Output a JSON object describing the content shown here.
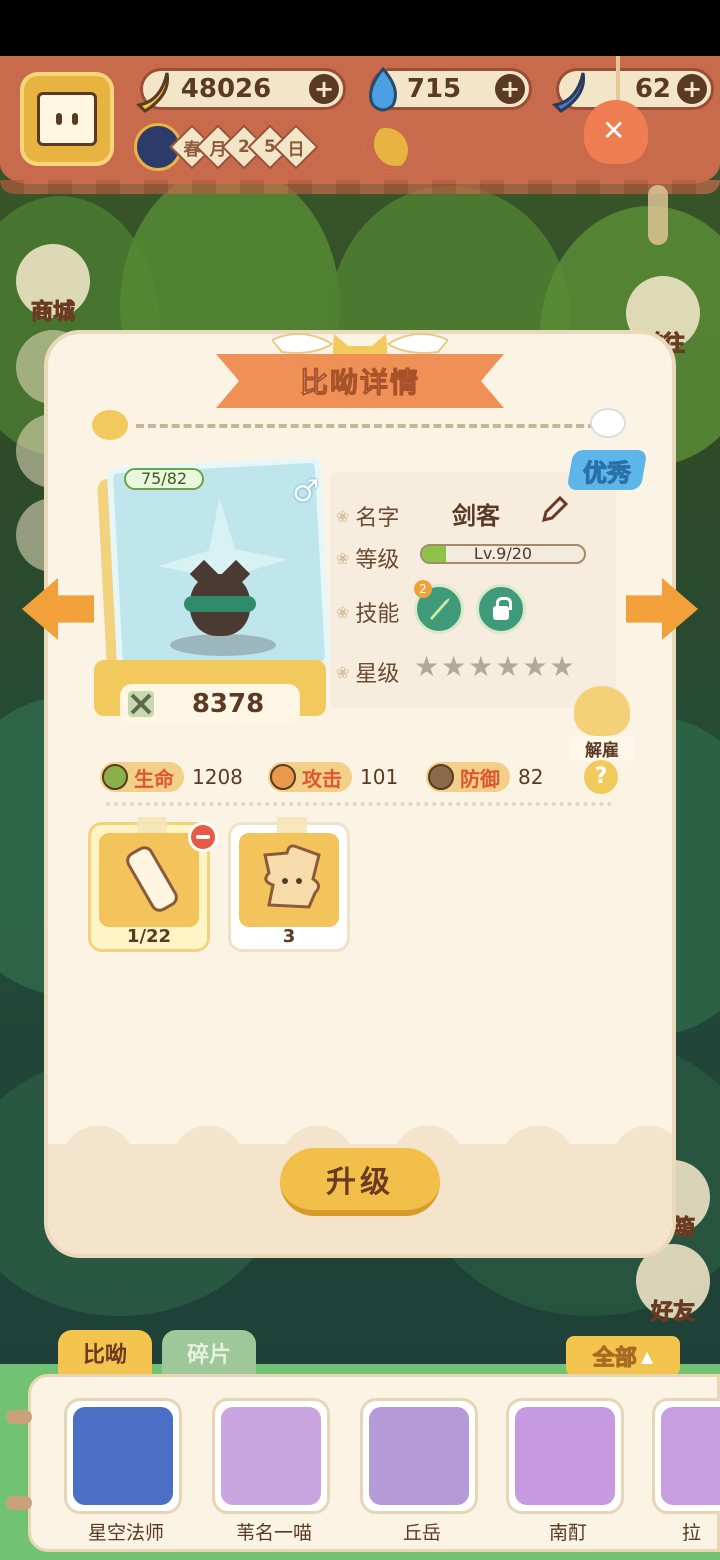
{
  "resources": {
    "bananas": "48026",
    "flames": "715",
    "blue_bananas": "62"
  },
  "date": {
    "chars": [
      "春",
      "月",
      "2",
      "5",
      "日"
    ]
  },
  "side_buttons": {
    "shop": "商城",
    "goto": "前往",
    "mail": "邮箱",
    "friends": "好友"
  },
  "panel": {
    "title": "比呦详情",
    "quality_badge": "优秀",
    "hp_indicator": "75/82",
    "power": "8378",
    "labels": {
      "name": "名字",
      "level": "等级",
      "skill": "技能",
      "star": "星级"
    },
    "name": "剑客",
    "level_text": "Lv.9/20",
    "level_progress": 0.15,
    "skill_level": "2",
    "stars_filled": 0,
    "stars_total": 6,
    "dismiss_label": "解雇",
    "stats": {
      "hp_label": "生命",
      "hp_value": "1208",
      "atk_label": "攻击",
      "atk_value": "101",
      "def_label": "防御",
      "def_value": "82"
    },
    "help": "?",
    "items": [
      {
        "count": "1/22"
      },
      {
        "count": "3"
      }
    ],
    "upgrade_label": "升级"
  },
  "tray": {
    "tab_active": "比呦",
    "tab_inactive": "碎片",
    "filter_label": "全部",
    "heroes": [
      {
        "name": "星空法师",
        "color": "#4a6fc4"
      },
      {
        "name": "苇名一喵",
        "color": "#c9a6e0"
      },
      {
        "name": "丘岳",
        "color": "#b69ad8"
      },
      {
        "name": "南酊",
        "color": "#c69ae0"
      },
      {
        "name": "拉",
        "color": "#c79ee0"
      }
    ]
  },
  "colors": {
    "accent_orange": "#ef9156",
    "badge_blue": "#5cb6ea",
    "button_yellow": "#f2c04a"
  }
}
